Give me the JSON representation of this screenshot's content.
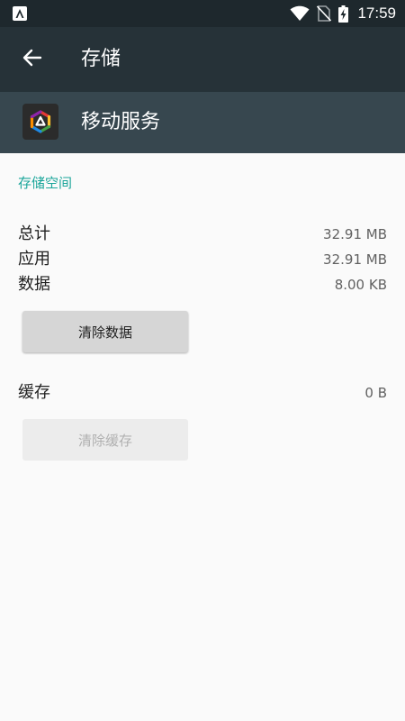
{
  "status_bar": {
    "time": "17:59",
    "icons": [
      "notification-a-icon",
      "wifi-icon",
      "no-sim-icon",
      "battery-charging-icon"
    ]
  },
  "toolbar": {
    "title": "存储",
    "back_icon": "arrow-left-icon"
  },
  "app_header": {
    "app_name": "移动服务",
    "app_icon": "mobile-services-icon"
  },
  "storage": {
    "section_title": "存储空间",
    "rows": [
      {
        "label": "总计",
        "value": "32.91 MB"
      },
      {
        "label": "应用",
        "value": "32.91 MB"
      },
      {
        "label": "数据",
        "value": "8.00 KB"
      }
    ],
    "clear_data_label": "清除数据"
  },
  "cache": {
    "label": "缓存",
    "value": "0 B",
    "clear_cache_label": "清除缓存"
  },
  "colors": {
    "status_bar_bg": "#1e282d",
    "toolbar_bg": "#263238",
    "header_bg": "#37474f",
    "accent": "#1aa59a",
    "background": "#fafafa"
  }
}
